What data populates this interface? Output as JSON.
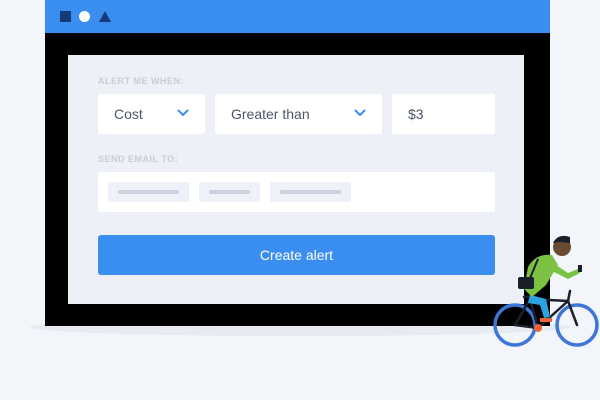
{
  "window": {
    "titlebar_icons": [
      "square-icon",
      "circle-icon",
      "triangle-icon"
    ],
    "titlebar_color": "#3a8ef0"
  },
  "alert_form": {
    "alert_label": "ALERT ME WHEN:",
    "metric": {
      "value": "Cost",
      "icon": "chevron-down-icon"
    },
    "comparison": {
      "value": "Greater than",
      "icon": "chevron-down-icon"
    },
    "threshold": {
      "value": "$3"
    },
    "email_label": "SEND EMAIL TO:",
    "email_chip_count": 3,
    "submit_label": "Create alert"
  },
  "colors": {
    "accent": "#3a8ef0",
    "cyclist_shirt": "#7cc242",
    "cyclist_pants": "#2aa3e0",
    "bike_wheels": "#3d76d6",
    "bike_accent": "#f0623a"
  }
}
